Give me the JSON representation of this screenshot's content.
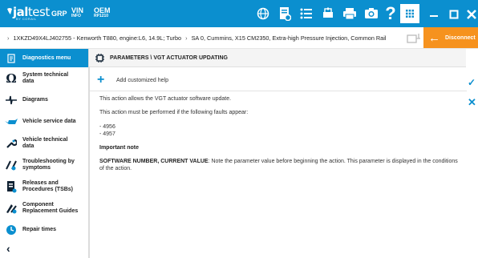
{
  "app": {
    "logo_bold": "jal",
    "logo_thin": "test",
    "logo_sub": "BY CORAIL",
    "brand_color": "#0b8fcf",
    "accent_color": "#f6921e"
  },
  "topnav": {
    "grp": "GRP",
    "vin_top": "VIN",
    "vin_bottom": "INFO",
    "oem_top": "OEM",
    "oem_bottom": "RP1210"
  },
  "toolbar_icons": [
    "globe-icon",
    "document-icon",
    "list-icon",
    "car-icon",
    "printer-icon",
    "camera-icon",
    "help-icon",
    "grid-icon",
    "minimize-icon",
    "maximize-icon",
    "close-icon"
  ],
  "help_label": "?",
  "breadcrumb": {
    "vehicle": "1XKZD49X4LJ402755 - Kenworth T880, engine:L6, 14.9L; Turbo",
    "system": "SA 0, Cummins, X15 CM2350, Extra-high Pressure Injection, Common Rail"
  },
  "disconnect": {
    "label": "Disconnect"
  },
  "sidebar": {
    "header": "Diagnostics menu",
    "items": [
      {
        "label_1": "System technical",
        "label_2": "data",
        "icon": "omega-icon"
      },
      {
        "label_1": "Diagrams",
        "label_2": "",
        "icon": "diagram-icon"
      },
      {
        "label_1": "Vehicle service data",
        "label_2": "",
        "icon": "oil-can-icon"
      },
      {
        "label_1": "Vehicle technical",
        "label_2": "data",
        "icon": "wrench-icon"
      },
      {
        "label_1": "Troubleshooting by",
        "label_2": "symptoms",
        "icon": "tools-icon"
      },
      {
        "label_1": "Releases and",
        "label_2": "Procedures (TSBs)",
        "icon": "book-icon"
      },
      {
        "label_1": "Component",
        "label_2": "Replacement Guides",
        "icon": "replace-tools-icon"
      },
      {
        "label_1": "Repair times",
        "label_2": "",
        "icon": "clock-icon"
      }
    ],
    "back": "‹"
  },
  "main": {
    "title": "PARAMETERS \\ VGT ACTUATOR UPDATING",
    "add_help": "Add customized help",
    "p1": "This action allows the VGT actuator software update.",
    "p2": "This action must be performed if the following faults appear:",
    "fault1": "- 4956",
    "fault2": "- 4957",
    "note_heading": "Important note",
    "note_bold": "SOFTWARE NUMBER, CURRENT VALUE",
    "note_text": ": Note the parameter value before beginning the action. This parameter is displayed in the conditions",
    "note_text_2": "of the action."
  },
  "actions": {
    "confirm": "✓",
    "cancel": "✕"
  }
}
